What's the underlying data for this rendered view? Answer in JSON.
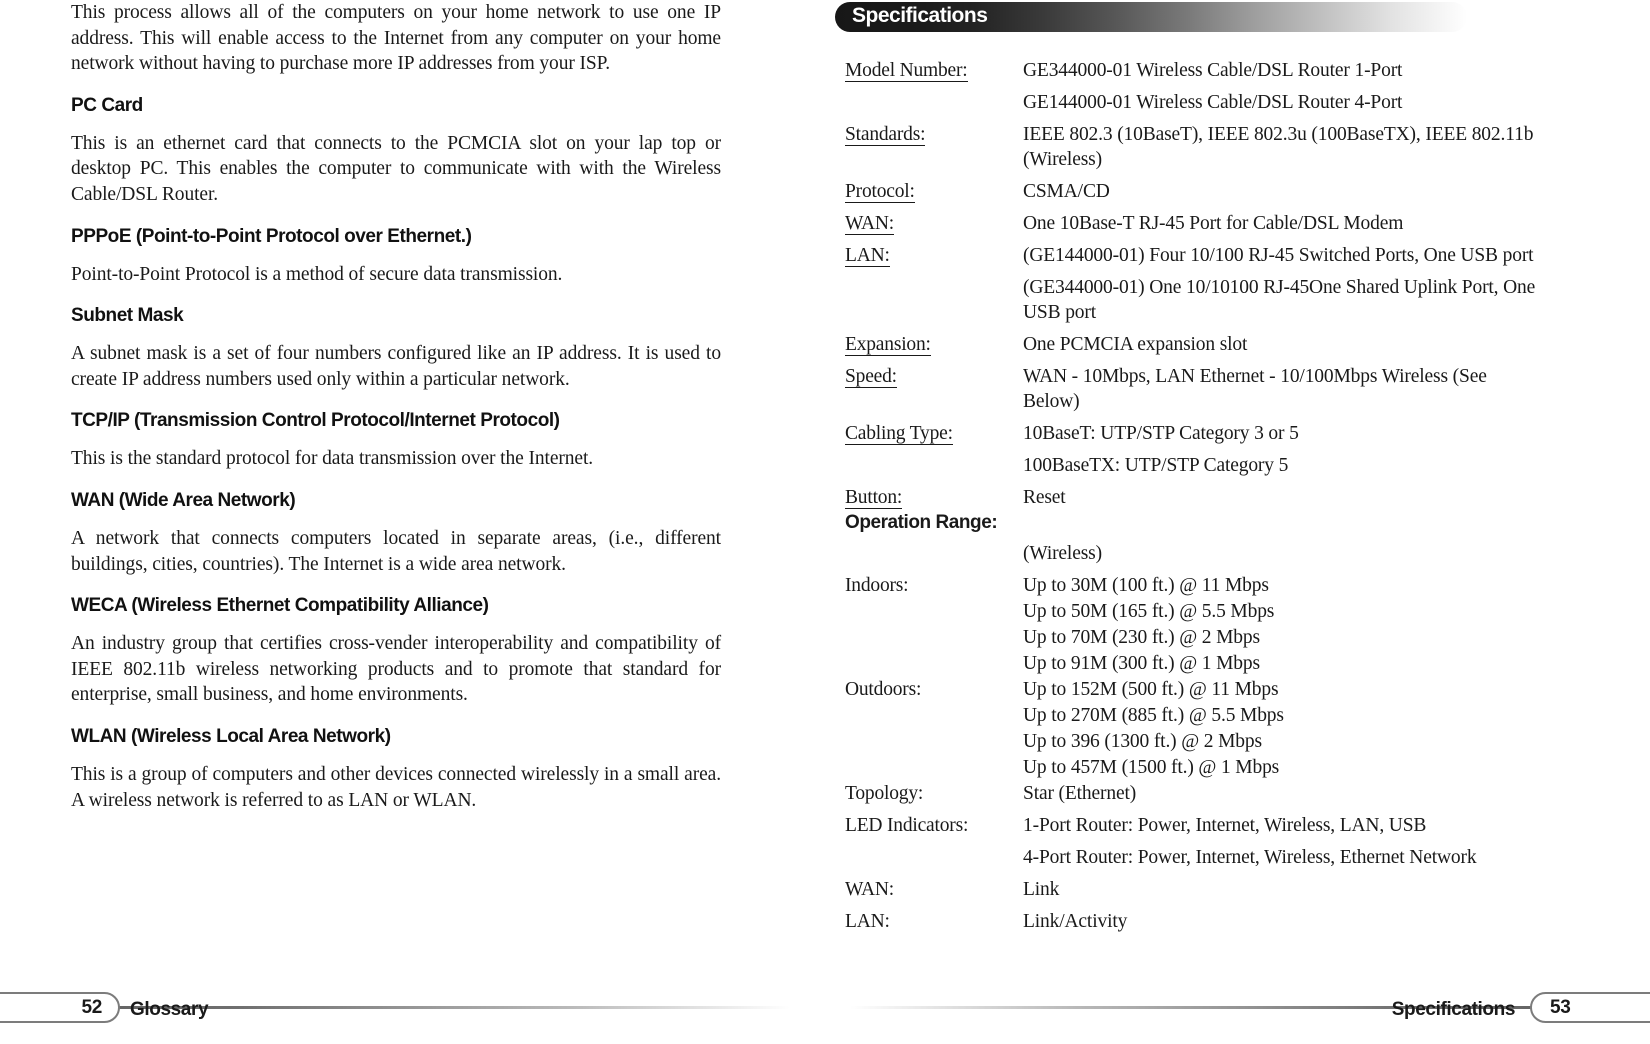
{
  "left_page": {
    "blocks": [
      {
        "type": "paragraph",
        "text": "This process allows all of the computers on your home network to use one IP address. This will enable access to the Internet from any computer on your home network without having to purchase more IP addresses from your ISP."
      },
      {
        "type": "heading",
        "text": "PC Card"
      },
      {
        "type": "paragraph",
        "text": "This is an ethernet card that connects to the PCMCIA slot on your lap top or desktop PC. This enables the computer to communicate with with the Wireless Cable/DSL Router."
      },
      {
        "type": "heading",
        "text": "PPPoE (Point-to-Point Protocol over Ethernet.)"
      },
      {
        "type": "paragraph",
        "text": "Point-to-Point Protocol is a method of secure data transmission."
      },
      {
        "type": "heading",
        "text": "Subnet Mask"
      },
      {
        "type": "paragraph",
        "text": "A subnet mask is a set of four numbers configured like an IP address. It is used to create IP address numbers used only within a particular network."
      },
      {
        "type": "heading",
        "text": "TCP/IP (Transmission Control Protocol/Internet Protocol)"
      },
      {
        "type": "paragraph",
        "text": "This is the standard protocol for data transmission over the Internet."
      },
      {
        "type": "heading",
        "text": "WAN (Wide Area Network)"
      },
      {
        "type": "paragraph",
        "text": "A network that connects computers located in separate areas, (i.e., different buildings, cities, countries). The Internet is a wide area network."
      },
      {
        "type": "heading",
        "text": "WECA (Wireless Ethernet Compatibility Alliance)"
      },
      {
        "type": "paragraph",
        "text": "An industry group that certifies cross-vender interoperability and compatibility of IEEE 802.11b wireless networking products and to promote that standard for enterprise, small business, and home environments."
      },
      {
        "type": "heading",
        "text": "WLAN (Wireless Local Area Network)"
      },
      {
        "type": "paragraph",
        "text": "This is a group of computers and other devices connected wirelessly in a small area. A wireless network is referred to as LAN or WLAN."
      }
    ],
    "footer": {
      "page_number": "52",
      "section_label": "Glossary"
    }
  },
  "right_page": {
    "header": {
      "title": "Specifications"
    },
    "spec_rows": [
      {
        "label": "Model Number:",
        "underlined": true,
        "value": "GE344000-01  Wireless Cable/DSL Router 1-Port"
      },
      {
        "label": "",
        "underlined": false,
        "value": "GE144000-01  Wireless Cable/DSL Router 4-Port"
      },
      {
        "label": "Standards:",
        "underlined": true,
        "value": "IEEE 802.3 (10BaseT), IEEE 802.3u (100BaseTX), IEEE 802.11b (Wireless)"
      },
      {
        "label": "Protocol:",
        "underlined": true,
        "value": "CSMA/CD"
      },
      {
        "label": "WAN:",
        "underlined": true,
        "value": "One 10Base-T RJ-45 Port for Cable/DSL Modem"
      },
      {
        "label": "LAN:",
        "underlined": true,
        "value": "(GE144000-01) Four 10/100 RJ-45 Switched Ports, One USB port"
      },
      {
        "label": "",
        "underlined": false,
        "value": "(GE344000-01) One 10/10100 RJ-45One Shared Uplink Port, One USB port"
      },
      {
        "label": "Expansion:",
        "underlined": true,
        "value": "One PCMCIA expansion slot"
      },
      {
        "label": "Speed:",
        "underlined": true,
        "value": "WAN - 10Mbps, LAN Ethernet - 10/100Mbps Wireless (See Below)"
      },
      {
        "label": "Cabling Type:",
        "underlined": true,
        "value": "10BaseT: UTP/STP Category 3 or 5"
      },
      {
        "label": "",
        "underlined": false,
        "value": "100BaseTX: UTP/STP Category 5"
      },
      {
        "label": "Button:",
        "underlined": true,
        "value": "Reset",
        "tight": true
      },
      {
        "label": "Operation Range:",
        "heading": true,
        "value": ""
      },
      {
        "label": "",
        "underlined": false,
        "value": "(Wireless)"
      },
      {
        "label": "Indoors:",
        "underlined": false,
        "value": "Up to 30M (100 ft.) @ 11 Mbps",
        "tight": true
      },
      {
        "label": "",
        "underlined": false,
        "value": "Up to 50M (165 ft.) @ 5.5 Mbps",
        "tight": true
      },
      {
        "label": "",
        "underlined": false,
        "value": "Up to 70M (230 ft.) @ 2 Mbps",
        "tight": true
      },
      {
        "label": "",
        "underlined": false,
        "value": "Up to 91M (300 ft.) @ 1 Mbps",
        "tight": true
      },
      {
        "label": "Outdoors:",
        "underlined": false,
        "value": "Up to 152M (500 ft.) @ 11 Mbps",
        "tight": true
      },
      {
        "label": "",
        "underlined": false,
        "value": "Up to 270M (885 ft.) @ 5.5 Mbps",
        "tight": true
      },
      {
        "label": "",
        "underlined": false,
        "value": "Up to 396 (1300 ft.) @ 2 Mbps",
        "tight": true
      },
      {
        "label": "",
        "underlined": false,
        "value": "Up to 457M (1500 ft.) @ 1 Mbps",
        "tight": true
      },
      {
        "label": "Topology:",
        "underlined": false,
        "value": "Star (Ethernet)"
      },
      {
        "label": "LED Indicators:",
        "underlined": false,
        "value": "1-Port Router: Power, Internet, Wireless, LAN, USB"
      },
      {
        "label": "",
        "underlined": false,
        "value": "4-Port Router: Power, Internet, Wireless, Ethernet Network"
      },
      {
        "label": "WAN:",
        "underlined": false,
        "value": "Link"
      },
      {
        "label": "LAN:",
        "underlined": false,
        "value": "Link/Activity"
      }
    ],
    "footer": {
      "page_number": "53",
      "section_label": "Specifications"
    }
  }
}
